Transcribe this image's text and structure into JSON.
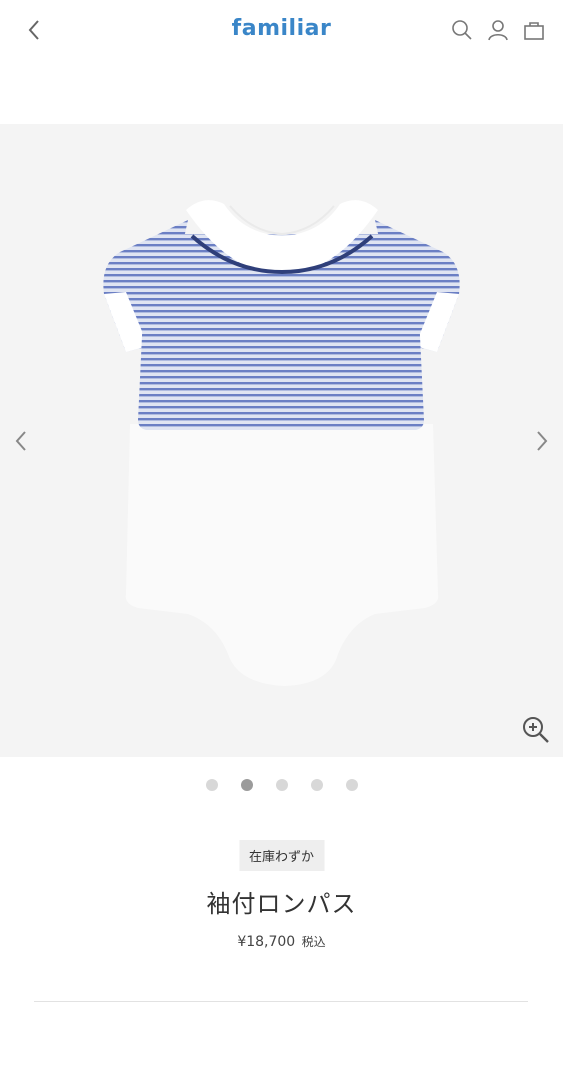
{
  "header": {
    "logo": "familiar",
    "brand_color": "#3a86c8"
  },
  "gallery": {
    "background": "#f4f4f4",
    "slide_count": 5,
    "active_slide": 2
  },
  "product": {
    "stock_badge": "在庫わずか",
    "name": "袖付ロンパス",
    "price": "¥18,700",
    "tax_label": "税込"
  },
  "icons": {
    "back": "chevron-left-icon",
    "search": "search-icon",
    "account": "user-icon",
    "cart": "bag-icon",
    "prev": "chevron-left-icon",
    "next": "chevron-right-icon",
    "zoom": "zoom-in-icon"
  }
}
